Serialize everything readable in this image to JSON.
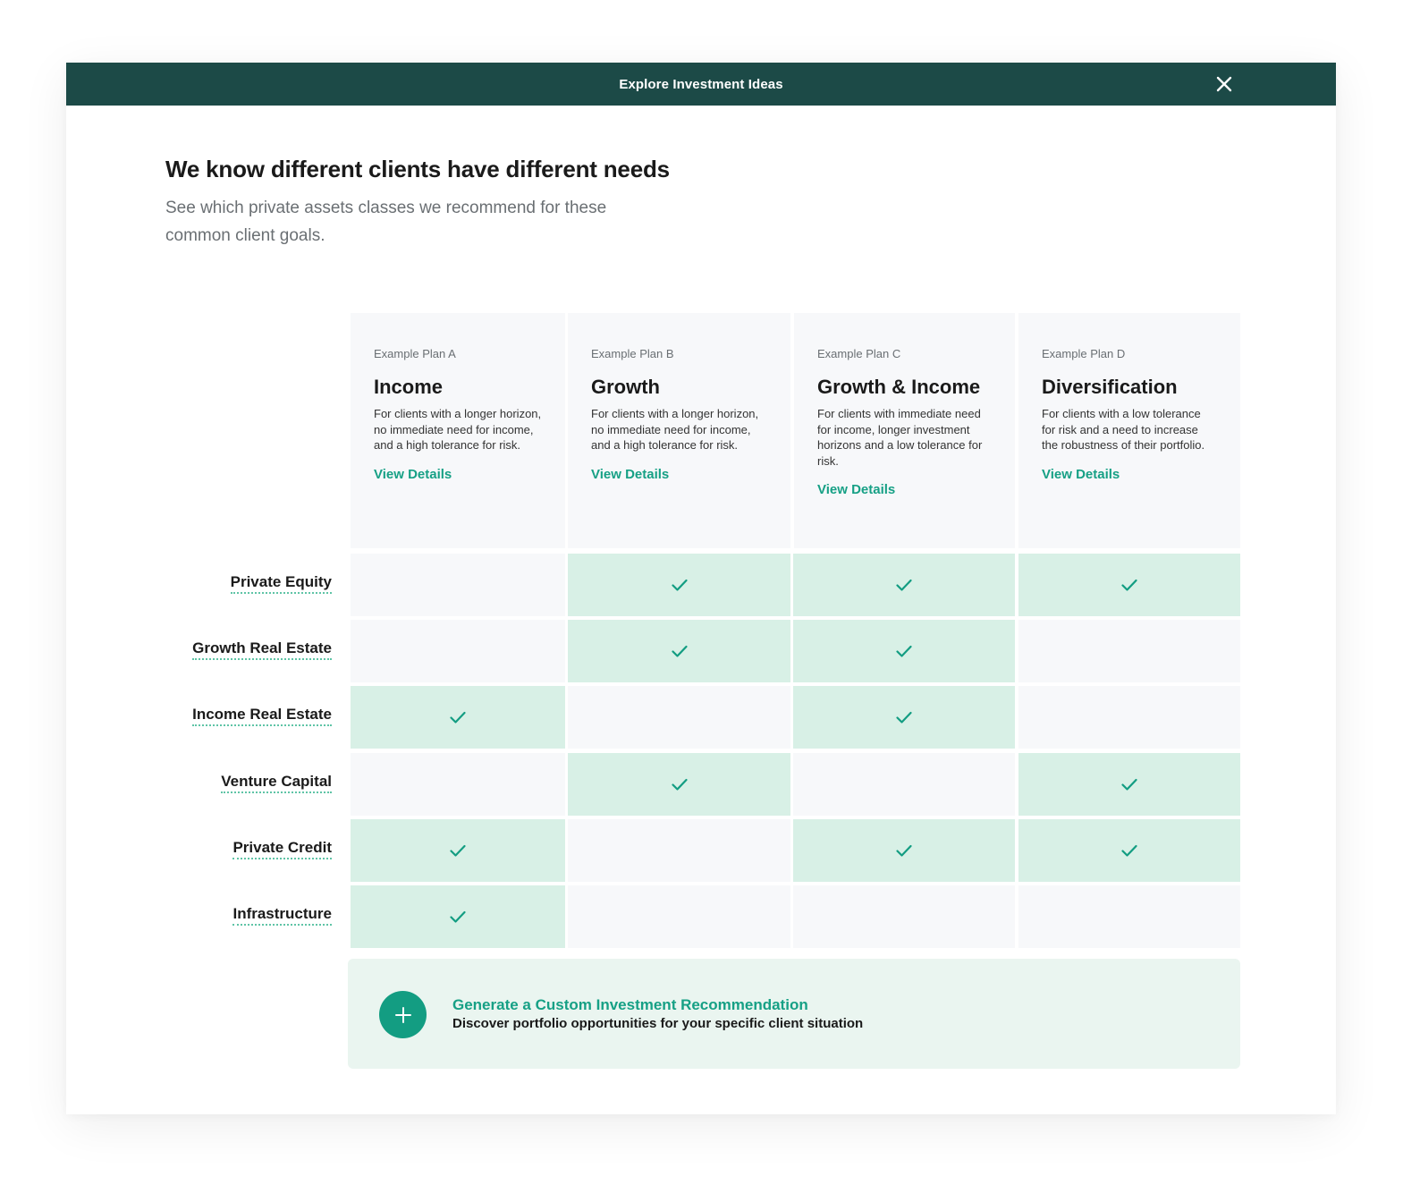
{
  "header": {
    "title": "Explore Investment Ideas",
    "close_icon": "close-icon"
  },
  "intro": {
    "heading": "We know different clients have different needs",
    "subheading": "See which private assets classes we recommend for these common client goals."
  },
  "plans": [
    {
      "eyebrow": "Example Plan A",
      "title": "Income",
      "description": "For clients with a longer horizon, no immediate need for income, and a high tolerance for risk.",
      "link": "View Details"
    },
    {
      "eyebrow": "Example Plan B",
      "title": "Growth",
      "description": "For clients with a longer horizon, no immediate need for income, and a high tolerance for risk.",
      "link": "View Details"
    },
    {
      "eyebrow": "Example Plan C",
      "title": "Growth & Income",
      "description": "For clients with immediate need for income, longer investment horizons and a low tolerance for risk.",
      "link": "View Details"
    },
    {
      "eyebrow": "Example Plan D",
      "title": "Diversification",
      "description": "For clients with a low tolerance for risk and a need to increase the robustness of their portfolio.",
      "link": "View Details"
    }
  ],
  "asset_classes": [
    {
      "label": "Private Equity",
      "included": [
        false,
        true,
        true,
        true
      ]
    },
    {
      "label": "Growth Real Estate",
      "included": [
        false,
        true,
        true,
        false
      ]
    },
    {
      "label": "Income Real Estate",
      "included": [
        true,
        false,
        true,
        false
      ]
    },
    {
      "label": "Venture Capital",
      "included": [
        false,
        true,
        false,
        true
      ]
    },
    {
      "label": "Private Credit",
      "included": [
        true,
        false,
        true,
        true
      ]
    },
    {
      "label": "Infrastructure",
      "included": [
        true,
        false,
        false,
        false
      ]
    }
  ],
  "colors": {
    "header_bg": "#1c4a47",
    "accent": "#16a085",
    "included_cell": "#d8f0e6",
    "empty_cell": "#f7f8fa"
  },
  "cta": {
    "title": "Generate a Custom Investment Recommendation",
    "subtitle": "Discover portfolio opportunities for your specific client situation",
    "icon": "plus-icon"
  }
}
